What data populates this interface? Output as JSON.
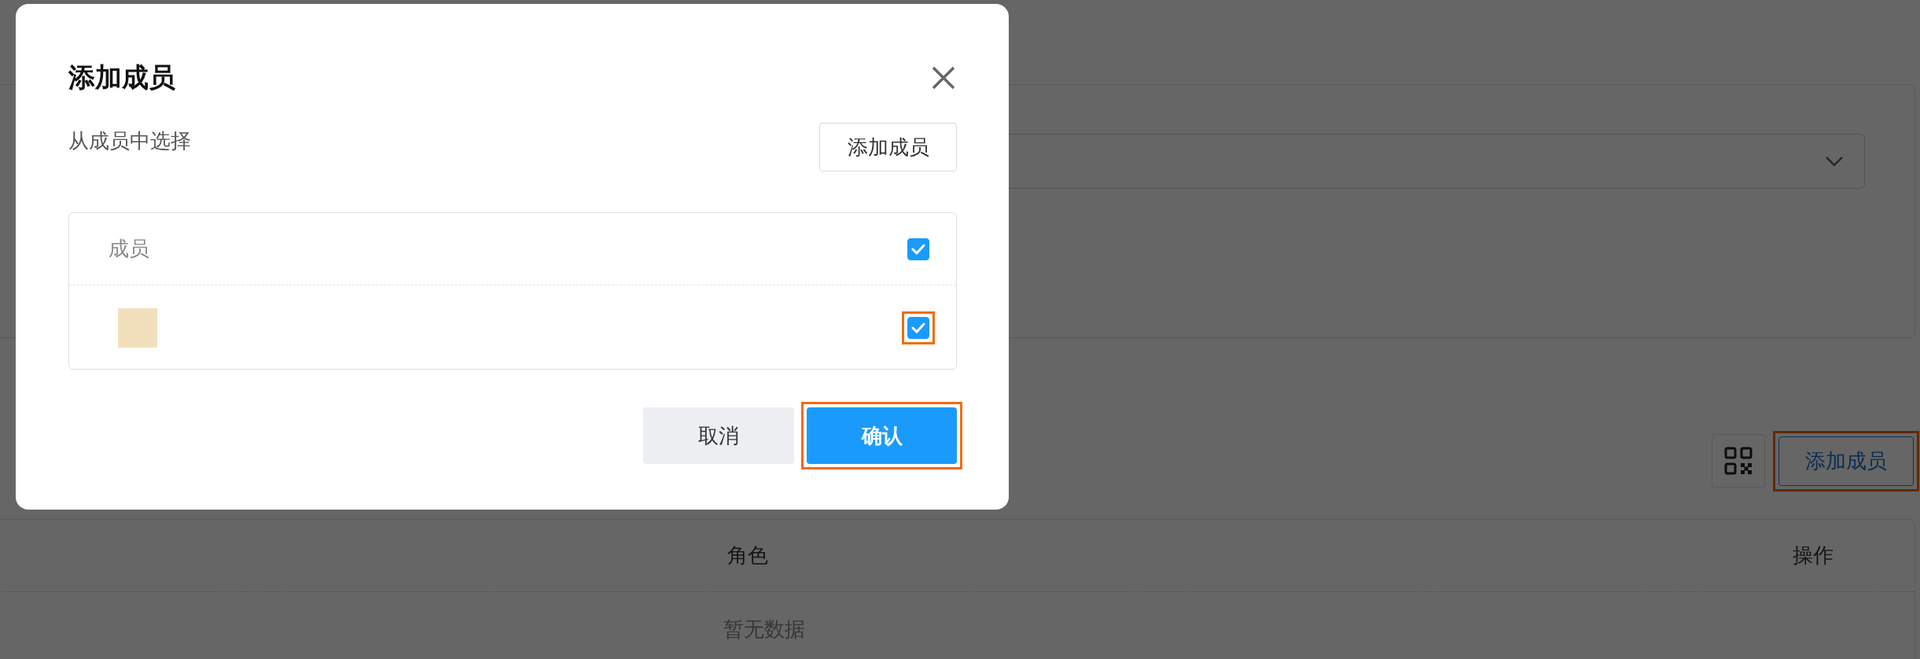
{
  "page": {
    "toolbar": {
      "add_button": {
        "label": "添加成员",
        "highlighted": true
      }
    },
    "table": {
      "columns": [
        {
          "label": "角色"
        },
        {
          "label": "操作"
        }
      ],
      "empty_text": "暂无数据"
    }
  },
  "dialog": {
    "title": "添加成员",
    "subtitle": "从成员中选择",
    "add_button": {
      "label": "添加成员",
      "highlighted": false
    },
    "member_table": {
      "header": {
        "label": "成员",
        "checked": true,
        "highlighted": false
      },
      "rows": [
        {
          "checked": true,
          "highlighted": true
        }
      ]
    },
    "buttons": [
      {
        "label": "取消",
        "kind": "secondary",
        "highlighted": false
      },
      {
        "label": "确认",
        "kind": "primary",
        "highlighted": true
      }
    ]
  }
}
